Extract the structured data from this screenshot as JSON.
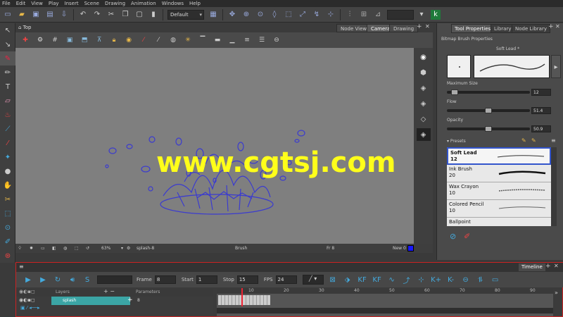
{
  "menu": [
    "File",
    "Edit",
    "View",
    "Play",
    "Insert",
    "Scene",
    "Drawing",
    "Animation",
    "Windows",
    "Help"
  ],
  "toolbar": {
    "workspace": "Default"
  },
  "view": {
    "title": "Top",
    "tabs": [
      "Node View",
      "Camera",
      "Drawing"
    ],
    "active_tab": "Camera",
    "status": {
      "zoom": "63%",
      "drawing": "splash-8",
      "tool": "Brush",
      "frame": "Fr 8",
      "new": "New 0"
    }
  },
  "watermark": "www.cgtsj.com",
  "right_panel": {
    "tabs": [
      "Tool Properties",
      "Library",
      "Node Library"
    ],
    "section": "Bitmap Brush Properties",
    "brush_name": "Soft Lead *",
    "max_size_label": "Maximum Size",
    "max_size": "12",
    "flow_label": "Flow",
    "flow": "51.4",
    "opacity_label": "Opacity",
    "opacity": "50.9",
    "presets_label": "Presets",
    "presets": [
      {
        "name": "Soft Lead",
        "size": "12"
      },
      {
        "name": "Ink Brush",
        "size": "20"
      },
      {
        "name": "Wax Crayon",
        "size": "10"
      },
      {
        "name": "Colored Pencil",
        "size": "10"
      },
      {
        "name": "Ballpoint",
        "size": ""
      }
    ]
  },
  "timeline": {
    "title": "Timeline",
    "frame_label": "Frame",
    "frame": "8",
    "start_label": "Start",
    "start": "1",
    "stop_label": "Stop",
    "stop": "15",
    "fps_label": "FPS",
    "fps": "24",
    "layers_label": "Layers",
    "params_label": "Parameters",
    "layer_name": "splash",
    "layer_value": "8",
    "ruler": [
      "10",
      "20",
      "30",
      "40",
      "50",
      "60",
      "70",
      "80",
      "90"
    ]
  },
  "colors": {
    "accent_red": "#cc2222",
    "selection_blue": "#3355cc",
    "watermark": "#ffff1a",
    "brush_stroke": "#3b3bcf"
  }
}
